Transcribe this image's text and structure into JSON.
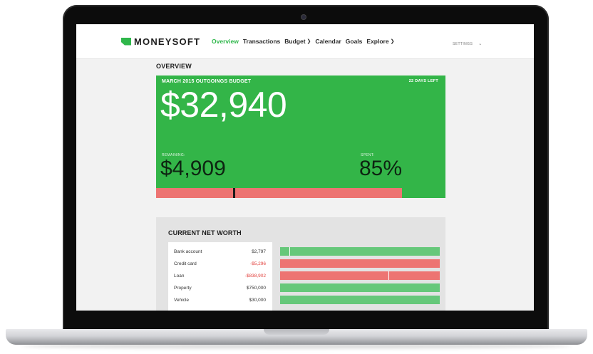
{
  "app": {
    "logo_text": "MONEYSOFT",
    "brand_color": "#2fb74b",
    "nav": [
      {
        "label": "Overview",
        "active": true,
        "has_dropdown": false
      },
      {
        "label": "Transactions",
        "active": false,
        "has_dropdown": false
      },
      {
        "label": "Budget",
        "active": false,
        "has_dropdown": true
      },
      {
        "label": "Calendar",
        "active": false,
        "has_dropdown": false
      },
      {
        "label": "Goals",
        "active": false,
        "has_dropdown": false
      },
      {
        "label": "Explore",
        "active": false,
        "has_dropdown": true
      }
    ],
    "settings_label": "SETTINGS",
    "chevron_icon": "chevron-down-icon"
  },
  "overview": {
    "title": "OVERVIEW",
    "budget": {
      "label": "MARCH 2015 OUTGOINGS BUDGET",
      "days_left": "22 DAYS LEFT",
      "amount": "$32,940",
      "remaining_label": "REMAINING:",
      "remaining_value": "$4,909",
      "spent_label": "SPENT:",
      "spent_value": "85%",
      "spent_fraction": 0.85,
      "marker_fraction": 0.265,
      "card_color": "#33b548",
      "bar_color": "#ed7472"
    }
  },
  "net_worth": {
    "title": "CURRENT NET WORTH",
    "rows": [
      {
        "name": "Bank account",
        "value": "$2,797",
        "negative": false,
        "fraction": 1.0,
        "tick": 0.06
      },
      {
        "name": "Credit card",
        "value": "-$5,296",
        "negative": true,
        "fraction": 1.0,
        "tick": null
      },
      {
        "name": "Loan",
        "value": "-$838,902",
        "negative": true,
        "fraction": 1.0,
        "tick": 0.68
      },
      {
        "name": "Property",
        "value": "$750,000",
        "negative": false,
        "fraction": 1.0,
        "tick": null
      },
      {
        "name": "Vehicle",
        "value": "$30,000",
        "negative": false,
        "fraction": 1.0,
        "tick": null
      }
    ],
    "positive_color": "#66c87a",
    "negative_color": "#ed7472"
  }
}
